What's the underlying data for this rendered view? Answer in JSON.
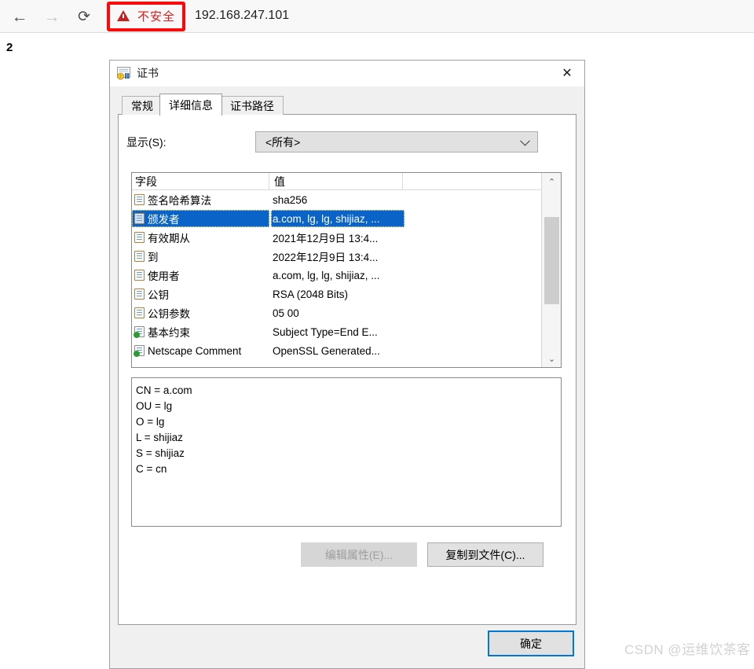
{
  "browser": {
    "back_icon": "arrow-left-icon",
    "forward_icon": "arrow-right-icon",
    "reload_icon": "reload-icon",
    "security_badge": {
      "icon": "warning-triangle-icon",
      "label": "不安全",
      "label_color": "#e11b1b",
      "highlight_box_color": "#fa0a0a"
    },
    "url": "192.168.247.101"
  },
  "page": {
    "body_text": "2"
  },
  "dialog": {
    "icon": "certificate-icon",
    "title": "证书",
    "close_icon": "close-icon",
    "tabs": [
      {
        "label": "常规",
        "active": false
      },
      {
        "label": "详细信息",
        "active": true
      },
      {
        "label": "证书路径",
        "active": false
      }
    ],
    "show_filter": {
      "label": "显示(S):",
      "value": "<所有>",
      "arrow_icon": "chevron-down-icon"
    },
    "field_list": {
      "columns": [
        "字段",
        "值"
      ],
      "rows": [
        {
          "field": "签名哈希算法",
          "value": "sha256",
          "icon": "field-icon",
          "selected": false
        },
        {
          "field": "颁发者",
          "value": "a.com, lg, lg, shijiaz, ...",
          "icon": "field-icon",
          "selected": true
        },
        {
          "field": "有效期从",
          "value": "2021年12月9日 13:4...",
          "icon": "field-icon",
          "selected": false
        },
        {
          "field": "到",
          "value": "2022年12月9日 13:4...",
          "icon": "field-icon",
          "selected": false
        },
        {
          "field": "使用者",
          "value": "a.com, lg, lg, shijiaz, ...",
          "icon": "field-icon",
          "selected": false
        },
        {
          "field": "公钥",
          "value": "RSA (2048 Bits)",
          "icon": "field-icon",
          "selected": false
        },
        {
          "field": "公钥参数",
          "value": "05 00",
          "icon": "field-icon",
          "selected": false
        },
        {
          "field": "基本约束",
          "value": "Subject Type=End E...",
          "icon": "extension-icon",
          "selected": false
        },
        {
          "field": "Netscape Comment",
          "value": "OpenSSL Generated...",
          "icon": "extension-icon",
          "selected": false
        }
      ],
      "scrollbar": {
        "up_icon": "chevron-up-icon",
        "down_icon": "chevron-down-icon"
      },
      "selection_color": "#0a64c8"
    },
    "detail_text": "CN = a.com\nOU = lg\nO = lg\nL = shijiaz\nS = shijiaz\nC = cn",
    "buttons": {
      "edit_properties": "编辑属性(E)...",
      "copy_to_file": "复制到文件(C)...",
      "ok": "确定"
    }
  },
  "watermark": "CSDN @运维饮茶客"
}
